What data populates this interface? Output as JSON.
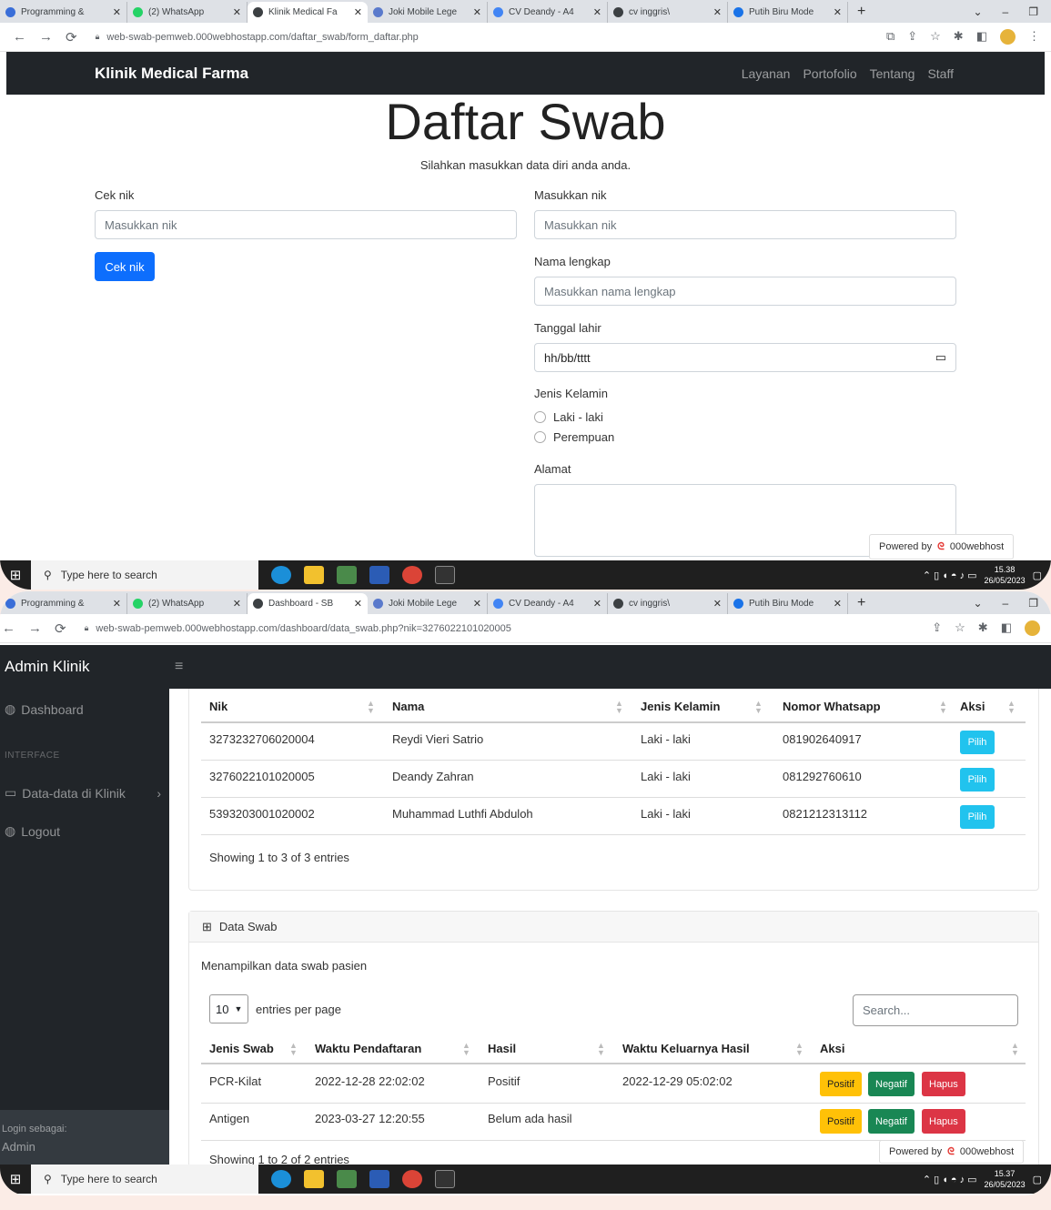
{
  "top": {
    "tabs": [
      {
        "title": "Programming &",
        "color": "#3a6ed8"
      },
      {
        "title": "(2) WhatsApp",
        "color": "#25d366"
      },
      {
        "title": "Klinik Medical Fa",
        "color": "#3c4043",
        "active": true
      },
      {
        "title": "Joki Mobile Lege",
        "color": "#5a7acc"
      },
      {
        "title": "CV Deandy - A4",
        "color": "#4285f4"
      },
      {
        "title": "cv inggris\\",
        "color": "#3c4043"
      },
      {
        "title": "Putih Biru Mode",
        "color": "#1a73e8"
      }
    ],
    "url": "web-swab-pemweb.000webhostapp.com/daftar_swab/form_daftar.php",
    "brand": "Klinik Medical Farma",
    "nav": [
      "Layanan",
      "Portofolio",
      "Tentang",
      "Staff"
    ],
    "title": "Daftar Swab",
    "subtitle": "Silahkan masukkan data diri anda anda.",
    "cek_label": "Cek nik",
    "cek_placeholder": "Masukkan nik",
    "cek_button": "Cek nik",
    "nik_label": "Masukkan nik",
    "nik_placeholder": "Masukkan nik",
    "nama_label": "Nama lengkap",
    "nama_placeholder": "Masukkan nama lengkap",
    "tgl_label": "Tanggal lahir",
    "tgl_value": "hh/bb/tttt",
    "jk_label": "Jenis Kelamin",
    "jk_opt1": "Laki - laki",
    "jk_opt2": "Perempuan",
    "alamat_label": "Alamat",
    "powered": "Powered by",
    "host": "000webhost",
    "search": "Type here to search",
    "time": "15.38",
    "date": "26/05/2023"
  },
  "bottom": {
    "tabs": [
      {
        "title": "Programming &",
        "color": "#3a6ed8"
      },
      {
        "title": "(2) WhatsApp",
        "color": "#25d366"
      },
      {
        "title": "Dashboard - SB",
        "color": "#3c4043",
        "active": true
      },
      {
        "title": "Joki Mobile Lege",
        "color": "#5a7acc"
      },
      {
        "title": "CV Deandy - A4",
        "color": "#4285f4"
      },
      {
        "title": "cv inggris\\",
        "color": "#3c4043"
      },
      {
        "title": "Putih Biru Mode",
        "color": "#1a73e8"
      }
    ],
    "url": "web-swab-pemweb.000webhostapp.com/dashboard/data_swab.php?nik=3276022101020005",
    "brand": "Admin Klinik",
    "menu_dashboard": "Dashboard",
    "menu_head": "INTERFACE",
    "menu_data": "Data-data di Klinik",
    "menu_logout": "Logout",
    "login_as": "Login sebagai:",
    "login_user": "Admin",
    "t1_cols": [
      "Nik",
      "Nama",
      "Jenis Kelamin",
      "Nomor Whatsapp",
      "Aksi"
    ],
    "t1_rows": [
      [
        "3273232706020004",
        "Reydi Vieri Satrio",
        "Laki - laki",
        "081902640917",
        "Pilih"
      ],
      [
        "3276022101020005",
        "Deandy Zahran",
        "Laki - laki",
        "081292760610",
        "Pilih"
      ],
      [
        "5393203001020002",
        "Muhammad Luthfi Abduloh",
        "Laki - laki",
        "0821212313112",
        "Pilih"
      ]
    ],
    "t1_info": "Showing 1 to 3 of 3 entries",
    "card2_title": "Data Swab",
    "card2_desc": "Menampilkan data swab pasien",
    "entries_value": "10",
    "entries_text": "entries per page",
    "search_placeholder": "Search...",
    "t2_cols": [
      "Jenis Swab",
      "Waktu Pendaftaran",
      "Hasil",
      "Waktu Keluarnya Hasil",
      "Aksi"
    ],
    "t2_rows": [
      [
        "PCR-Kilat",
        "2022-12-28 22:02:02",
        "Positif",
        "2022-12-29 05:02:02"
      ],
      [
        "Antigen",
        "2023-03-27 12:20:55",
        "Belum ada hasil",
        ""
      ]
    ],
    "btn_pos": "Positif",
    "btn_neg": "Negatif",
    "btn_del": "Hapus",
    "t2_info": "Showing 1 to 2 of 2 entries",
    "powered": "Powered by",
    "host": "000webhost",
    "search": "Type here to search",
    "time": "15.37",
    "date": "26/05/2023"
  }
}
